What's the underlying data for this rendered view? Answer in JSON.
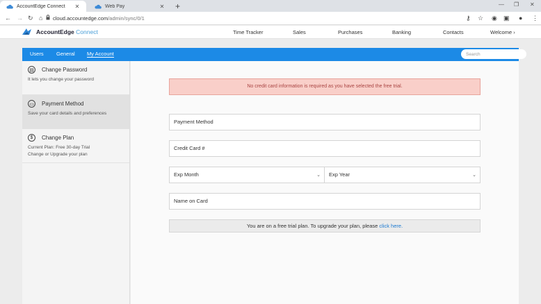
{
  "browser": {
    "tabs": [
      {
        "title": "AccountEdge Connect",
        "active": true
      },
      {
        "title": "Web Pay",
        "active": false
      }
    ],
    "url_host": "cloud.accountedge.com",
    "url_path": "/admin/sync/0/1"
  },
  "app": {
    "logo_bold": "AccountEdge",
    "logo_light": "Connect",
    "nav": [
      "Time Tracker",
      "Sales",
      "Purchases",
      "Banking",
      "Contacts",
      "Welcome"
    ]
  },
  "subnav": {
    "links": [
      "Users",
      "General",
      "My Account"
    ],
    "active": "My Account",
    "search_placeholder": "Search"
  },
  "sidebar": {
    "items": [
      {
        "label": "Change Password",
        "desc1": "It lets you change your password",
        "desc2": "",
        "icon": "lock-icon"
      },
      {
        "label": "Payment Method",
        "desc1": "Save your card details and preferences",
        "desc2": "",
        "icon": "card-icon"
      },
      {
        "label": "Change Plan",
        "desc1": "Current Plan: Free 30-day Trial",
        "desc2": "Change or Upgrade your plan",
        "icon": "dollar-icon"
      }
    ]
  },
  "form": {
    "alert": "No credit card information is required as you have selected the free trial.",
    "payment_method": "Payment Method",
    "credit_card": "Credit Card #",
    "exp_month": "Exp Month",
    "exp_year": "Exp Year",
    "name_on_card": "Name on Card",
    "info_text": "You are on a free trial plan. To upgrade your plan, please",
    "info_link": "click here."
  },
  "colors": {
    "accent": "#1c8ae6",
    "alert_bg": "#f9cfc9",
    "alert_text": "#a94442"
  }
}
